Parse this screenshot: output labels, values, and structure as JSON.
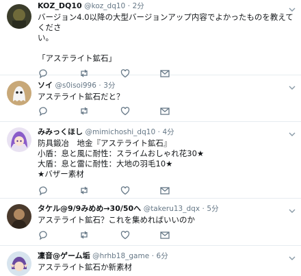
{
  "tweets": [
    {
      "name": "KOZ_DQ10",
      "handle": "@koz_dq10",
      "dot": "·",
      "time": "2分",
      "text": "バージョン4.0以降の大型バージョンアップ内容でよかったものを教えてくださ\nい。\n\n「アステライト鉱石」",
      "avatar_icon": "avatar-dark-character"
    },
    {
      "name": "ソイ",
      "handle": "@s0isoi996",
      "dot": "·",
      "time": "3分",
      "text": "アステライト鉱石だと？",
      "avatar_icon": "avatar-ghost"
    },
    {
      "name": "みみっくほし",
      "handle": "@mimichoshi_dq10",
      "dot": "·",
      "time": "4分",
      "text": "防具鍛冶　地金『アステライト鉱石』\n小盾：息と風に耐性：スライムおしゃれ花30★\n大盾：息と雷に耐性：大地の羽毛10★\n★バザー素材",
      "avatar_icon": "avatar-purple-hair-girl"
    },
    {
      "name": "タケル@9/9みめめ→30/50へ",
      "handle": "@takeru13_dqx",
      "dot": "·",
      "time": "5分",
      "text": "アステライト鉱石？これを集めればいいのか",
      "avatar_icon": "avatar-warrior"
    },
    {
      "name": "凜音@ゲーム垢",
      "handle": "@hrhb18_game",
      "dot": "·",
      "time": "6分",
      "text": "アステライト鉱石か新素材",
      "avatar_icon": "avatar-elf"
    }
  ],
  "icons": {
    "reply": "reply-icon",
    "retweet": "retweet-icon",
    "like": "heart-icon",
    "dm": "mail-icon",
    "caret": "chevron-down-icon"
  },
  "colors": {
    "secondary_text": "#657786",
    "divider": "#e6ecf0"
  }
}
